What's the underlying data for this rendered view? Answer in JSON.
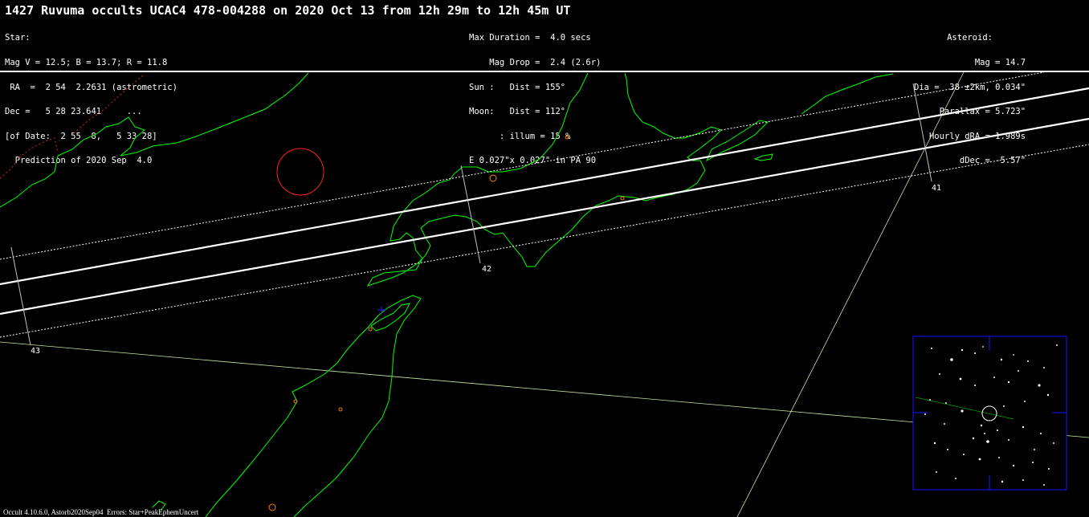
{
  "title": "1427 Ruvuma occults UCAC4 478-004288 on 2020 Oct 13 from 12h 29m to 12h 45m UT",
  "star_block": [
    "Star:",
    "Mag V = 12.5; B = 13.7; R = 11.8",
    " RA  =  2 54  2.2631 (astrometric)",
    "Dec =   5 28 23.641     ...",
    "[of Date:  2 55  8,   5 33 28]",
    "  Prediction of 2020 Sep  4.0"
  ],
  "event_block": [
    "Max Duration =  4.0 secs",
    "    Mag Drop =  2.4 (2.6r)",
    "Sun :   Dist = 155°",
    "Moon:   Dist = 112°",
    "      : illum = 15 %",
    "E 0.027\"x 0.027\" in PA 90"
  ],
  "asteroid_block": [
    "Asteroid:",
    "Mag = 14.7",
    "Dia =  38 ±2km, 0.034\"",
    "Parallax = 5.723\"",
    "Hourly dRA =-1.989s",
    "dDec = -5.57\""
  ],
  "time_labels": [
    "41",
    "42",
    "43"
  ],
  "footer": "Occult 4.10.6.0, Astorb2020Sep04  Errors: Star+PeakEphemUncert",
  "colors": {
    "background": "#000000",
    "coastline": "#00ff00",
    "path_lines": "#ffffff",
    "time_ticks": "#c0c0c0",
    "grid": "#c8e6a0",
    "sun_circle": "#ff2020",
    "sites": "#ff8000",
    "frame": "#1010e0",
    "center_mark": "#0000ff"
  }
}
